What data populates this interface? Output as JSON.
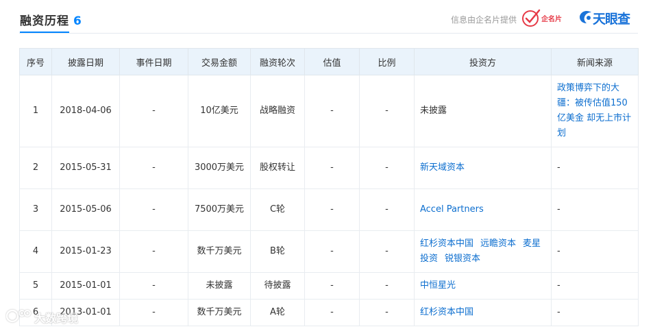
{
  "header": {
    "title": "融资历程",
    "count": "6",
    "provider_text": "信息由企名片提供",
    "provider_logo_text": "企名片",
    "brand": "天眼查"
  },
  "table": {
    "columns": [
      "序号",
      "披露日期",
      "事件日期",
      "交易金额",
      "融资轮次",
      "估值",
      "比例",
      "投资方",
      "新闻来源"
    ],
    "rows": [
      {
        "index": "1",
        "disclosure_date": "2018-04-06",
        "event_date": "-",
        "amount": "10亿美元",
        "round": "战略融资",
        "valuation": "-",
        "ratio": "-",
        "investors": [
          "未披露"
        ],
        "investors_linked": false,
        "news": "政策博弈下的大疆：被传估值150亿美金 却无上市计划",
        "news_linked": true
      },
      {
        "index": "2",
        "disclosure_date": "2015-05-31",
        "event_date": "-",
        "amount": "3000万美元",
        "round": "股权转让",
        "valuation": "-",
        "ratio": "-",
        "investors": [
          "新天域资本"
        ],
        "investors_linked": true,
        "news": "-",
        "news_linked": false
      },
      {
        "index": "3",
        "disclosure_date": "2015-05-06",
        "event_date": "-",
        "amount": "7500万美元",
        "round": "C轮",
        "valuation": "-",
        "ratio": "-",
        "investors": [
          "Accel Partners"
        ],
        "investors_linked": true,
        "news": "-",
        "news_linked": false
      },
      {
        "index": "4",
        "disclosure_date": "2015-01-23",
        "event_date": "-",
        "amount": "数千万美元",
        "round": "B轮",
        "valuation": "-",
        "ratio": "-",
        "investors": [
          "红杉资本中国",
          "远瞻资本",
          "麦星投资",
          "锐银资本"
        ],
        "investors_linked": true,
        "news": "-",
        "news_linked": false
      },
      {
        "index": "5",
        "disclosure_date": "2015-01-01",
        "event_date": "-",
        "amount": "未披露",
        "round": "待披露",
        "valuation": "-",
        "ratio": "-",
        "investors": [
          "中恒星光"
        ],
        "investors_linked": true,
        "news": "-",
        "news_linked": false
      },
      {
        "index": "6",
        "disclosure_date": "2013-01-01",
        "event_date": "-",
        "amount": "数千万美元",
        "round": "A轮",
        "valuation": "-",
        "ratio": "-",
        "investors": [
          "红杉资本中国"
        ],
        "investors_linked": true,
        "news": "-",
        "news_linked": false
      }
    ]
  },
  "watermark": {
    "text": "大数跨境"
  },
  "colors": {
    "accent": "#0084ff",
    "link": "#0c6ecf",
    "header_bg": "#eaf3fb",
    "brand_red": "#e63946"
  }
}
